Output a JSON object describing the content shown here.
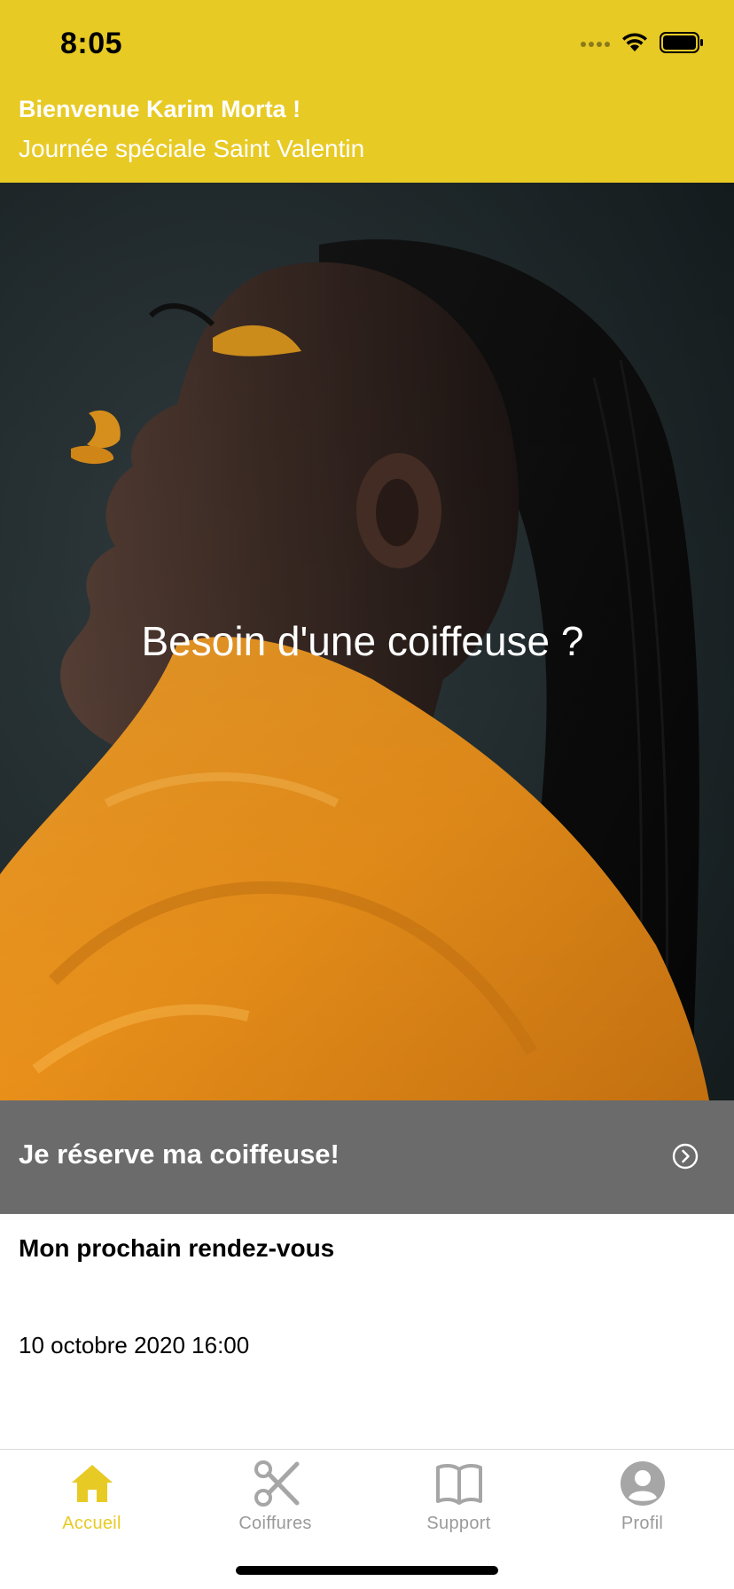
{
  "status_bar": {
    "time": "8:05"
  },
  "header": {
    "greeting": "Bienvenue Karim Morta !",
    "subtitle": "Journée spéciale Saint Valentin",
    "background": "#e8ca25"
  },
  "hero": {
    "headline": "Besoin d'une coiffeuse ?"
  },
  "reserve": {
    "label": "Je réserve ma coiffeuse!",
    "icon": "chevron-right-circle-icon"
  },
  "appointment": {
    "title": "Mon prochain rendez-vous",
    "datetime": "10 octobre 2020 16:00"
  },
  "tabs": [
    {
      "label": "Accueil",
      "icon": "home-icon",
      "active": true
    },
    {
      "label": "Coiffures",
      "icon": "scissors-icon",
      "active": false
    },
    {
      "label": "Support",
      "icon": "book-icon",
      "active": false
    },
    {
      "label": "Profil",
      "icon": "user-circle-icon",
      "active": false
    }
  ],
  "colors": {
    "accent": "#e8ca25",
    "reserve_bar": "#6b6b6b",
    "inactive_tab": "#9a9a9a"
  }
}
